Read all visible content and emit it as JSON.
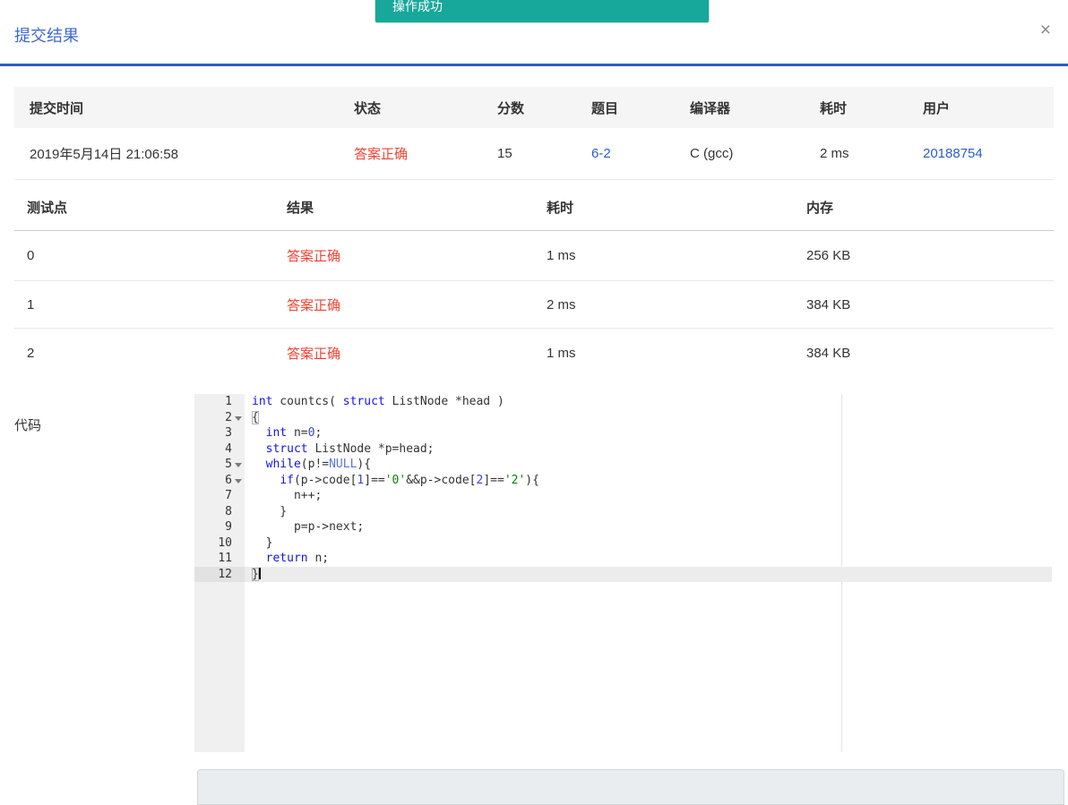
{
  "colors": {
    "toast_teal": "#18a79b",
    "accent_blue": "#2b5bc7",
    "title_blue": "#3e68cd",
    "link_blue": "#2a5fc4",
    "status_red": "#ee4334"
  },
  "toast": {
    "message": "操作成功"
  },
  "modal": {
    "title": "提交结果",
    "close_label": "×"
  },
  "submission_table": {
    "headers": [
      "提交时间",
      "状态",
      "分数",
      "题目",
      "编译器",
      "耗时",
      "用户"
    ],
    "row": {
      "time": "2019年5月14日 21:06:58",
      "status": "答案正确",
      "score": "15",
      "problem": "6-2",
      "compiler": "C (gcc)",
      "duration": "2 ms",
      "user": "20188754"
    }
  },
  "testcase_table": {
    "headers": [
      "测试点",
      "结果",
      "耗时",
      "内存"
    ],
    "rows": [
      {
        "id": "0",
        "result": "答案正确",
        "duration": "1 ms",
        "memory": "256 KB"
      },
      {
        "id": "1",
        "result": "答案正确",
        "duration": "2 ms",
        "memory": "384 KB"
      },
      {
        "id": "2",
        "result": "答案正确",
        "duration": "1 ms",
        "memory": "384 KB"
      }
    ]
  },
  "code_section": {
    "label": "代码",
    "lines": [
      {
        "n": 1,
        "tokens": [
          {
            "c": "kw",
            "t": "int"
          },
          {
            "c": "p",
            "t": " countcs( "
          },
          {
            "c": "kw",
            "t": "struct"
          },
          {
            "c": "p",
            "t": " ListNode *head )"
          }
        ]
      },
      {
        "n": 2,
        "fold": true,
        "tokens": [
          {
            "c": "mark",
            "t": "{"
          }
        ]
      },
      {
        "n": 3,
        "tokens": [
          {
            "c": "p",
            "t": "  "
          },
          {
            "c": "kw",
            "t": "int"
          },
          {
            "c": "p",
            "t": " n="
          },
          {
            "c": "num",
            "t": "0"
          },
          {
            "c": "p",
            "t": ";"
          }
        ]
      },
      {
        "n": 4,
        "tokens": [
          {
            "c": "p",
            "t": "  "
          },
          {
            "c": "kw",
            "t": "struct"
          },
          {
            "c": "p",
            "t": " ListNode *p=head;"
          }
        ]
      },
      {
        "n": 5,
        "fold": true,
        "tokens": [
          {
            "c": "p",
            "t": "  "
          },
          {
            "c": "kw",
            "t": "while"
          },
          {
            "c": "p",
            "t": "(p!="
          },
          {
            "c": "const",
            "t": "NULL"
          },
          {
            "c": "p",
            "t": "){"
          }
        ]
      },
      {
        "n": 6,
        "fold": true,
        "tokens": [
          {
            "c": "p",
            "t": "    "
          },
          {
            "c": "kw",
            "t": "if"
          },
          {
            "c": "p",
            "t": "(p->code["
          },
          {
            "c": "num",
            "t": "1"
          },
          {
            "c": "p",
            "t": "]=="
          },
          {
            "c": "str",
            "t": "'0'"
          },
          {
            "c": "p",
            "t": "&&p->code["
          },
          {
            "c": "num",
            "t": "2"
          },
          {
            "c": "p",
            "t": "]=="
          },
          {
            "c": "str",
            "t": "'2'"
          },
          {
            "c": "p",
            "t": "){"
          }
        ]
      },
      {
        "n": 7,
        "tokens": [
          {
            "c": "p",
            "t": "      n++;"
          }
        ]
      },
      {
        "n": 8,
        "tokens": [
          {
            "c": "p",
            "t": "    }"
          }
        ]
      },
      {
        "n": 9,
        "tokens": [
          {
            "c": "p",
            "t": "      p=p->next;"
          }
        ]
      },
      {
        "n": 10,
        "tokens": [
          {
            "c": "p",
            "t": "  }"
          }
        ]
      },
      {
        "n": 11,
        "tokens": [
          {
            "c": "p",
            "t": "  "
          },
          {
            "c": "kw",
            "t": "return"
          },
          {
            "c": "p",
            "t": " n;"
          }
        ]
      },
      {
        "n": 12,
        "active": true,
        "tokens": [
          {
            "c": "mark",
            "t": "}"
          }
        ]
      }
    ]
  }
}
